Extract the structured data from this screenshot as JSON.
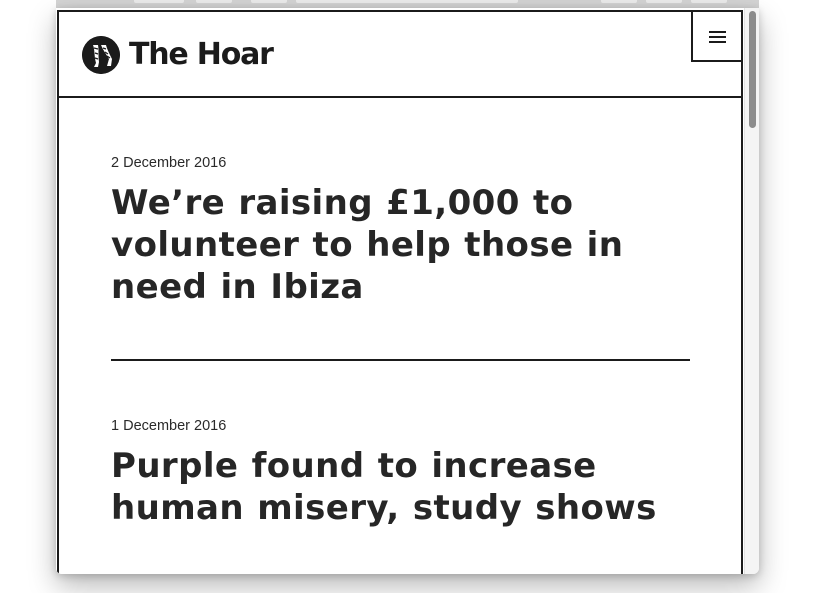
{
  "site": {
    "title": "The Hoar"
  },
  "posts": [
    {
      "date": "2 December 2016",
      "title": "We’re raising £1,000 to volunteer to help those in need in Ibiza"
    },
    {
      "date": "1 December 2016",
      "title": "Purple found to increase human misery, study shows"
    }
  ],
  "icons": {
    "logo": "legs-logo-icon",
    "menu": "hamburger-menu-icon"
  },
  "colors": {
    "ink": "#1b1b1b",
    "background": "#ffffff"
  }
}
